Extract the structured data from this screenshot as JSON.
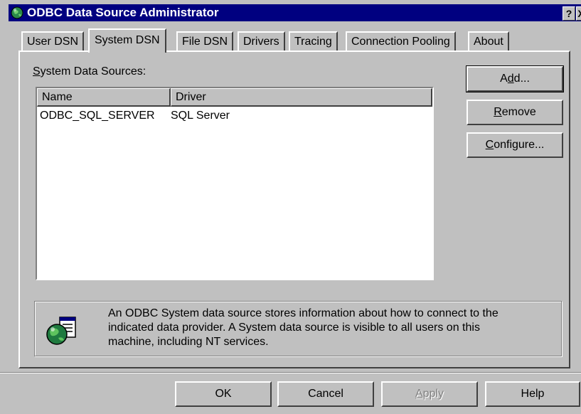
{
  "window": {
    "title": "ODBC Data Source Administrator",
    "help_glyph": "?",
    "close_glyph": "X"
  },
  "tabs": [
    {
      "label": "User DSN",
      "active": false
    },
    {
      "label": "System DSN",
      "active": true
    },
    {
      "label": "File DSN",
      "active": false
    },
    {
      "label": "Drivers",
      "active": false
    },
    {
      "label": "Tracing",
      "active": false
    },
    {
      "label": "Connection Pooling",
      "active": false
    },
    {
      "label": "About",
      "active": false
    }
  ],
  "list": {
    "label_hotkey": "S",
    "label_rest": "ystem Data Sources:",
    "columns": [
      "Name",
      "Driver"
    ],
    "rows": [
      {
        "name": "ODBC_SQL_SERVER",
        "driver": "SQL Server"
      }
    ]
  },
  "side_buttons": {
    "add": {
      "pre": "A",
      "hot": "d",
      "post": "d..."
    },
    "remove": {
      "pre": "",
      "hot": "R",
      "post": "emove"
    },
    "configure": {
      "pre": "",
      "hot": "C",
      "post": "onfigure..."
    }
  },
  "info": {
    "icon": "globe-datasource-icon",
    "lines": [
      "An ODBC System data source stores information about how to connect to the",
      "indicated data provider.  A System data source is visible to all users on this",
      "machine, including NT services."
    ]
  },
  "footer_buttons": {
    "ok": "OK",
    "cancel": "Cancel",
    "apply_hot": "A",
    "apply_rest": "pply",
    "help": "Help"
  },
  "colors": {
    "titlebar": "#000080",
    "face": "#c0c0c0",
    "shadow": "#808080",
    "highlight": "#ffffff"
  }
}
